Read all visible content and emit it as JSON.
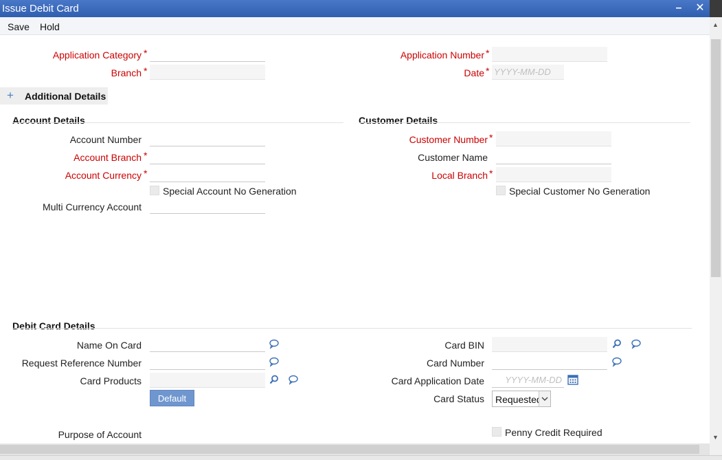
{
  "window": {
    "title": "Issue Debit Card",
    "minimize": "–",
    "close": "✕"
  },
  "toolbar": {
    "save": "Save",
    "hold": "Hold"
  },
  "header": {
    "application_category": "Application Category",
    "branch": "Branch",
    "application_number": "Application Number",
    "date": "Date",
    "date_placeholder": "YYYY-MM-DD",
    "required_mark": "*"
  },
  "additional_details": {
    "icon": "plus-icon",
    "label": "Additional Details"
  },
  "account_details": {
    "title": "Account Details",
    "account_number": "Account Number",
    "account_branch": "Account Branch",
    "account_currency": "Account Currency",
    "special_account_no_generation": "Special Account No Generation",
    "multi_currency_account": "Multi Currency Account"
  },
  "customer_details": {
    "title": "Customer Details",
    "customer_number": "Customer Number",
    "customer_name": "Customer Name",
    "local_branch": "Local Branch",
    "special_customer_no_generation": "Special Customer No Generation"
  },
  "debit_card_details": {
    "title": "Debit Card Details",
    "name_on_card": "Name On Card",
    "request_reference_number": "Request Reference Number",
    "card_products": "Card Products",
    "default_button": "Default",
    "card_bin": "Card BIN",
    "card_number": "Card Number",
    "card_application_date": "Card Application Date",
    "card_application_date_placeholder": "YYYY-MM-DD",
    "card_status": "Card Status",
    "card_status_value": "Requested",
    "purpose_of_account": "Purpose of Account",
    "penny_credit_required": "Penny Credit Required"
  },
  "colors": {
    "title_bar": "#3a68b8",
    "required": "#cc0000",
    "button": "#6f96cf",
    "icon": "#3b6fb6"
  }
}
